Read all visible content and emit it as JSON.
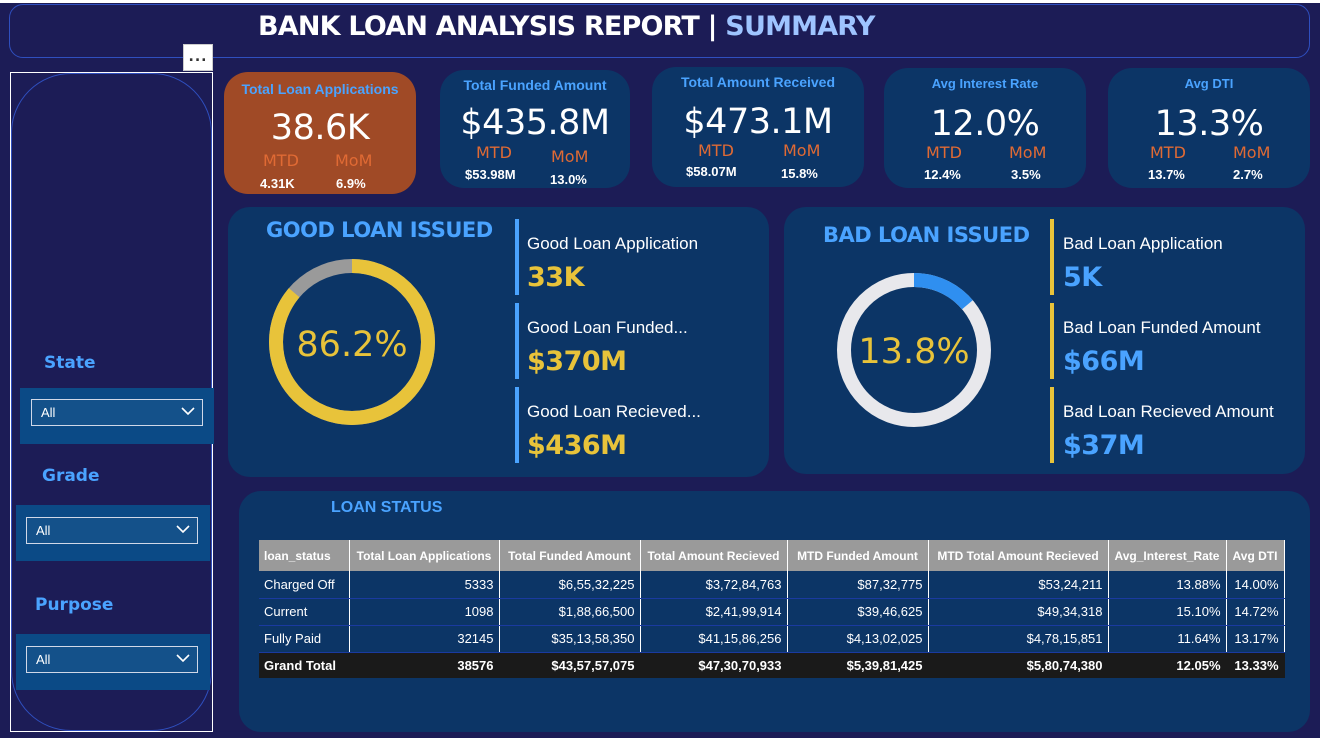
{
  "header": {
    "title_main": "BANK LOAN ANALYSIS REPORT",
    "title_sep": "|",
    "title_accent": "SUMMARY",
    "more_label": "..."
  },
  "slicers": [
    {
      "label": "State",
      "value": "All"
    },
    {
      "label": "Grade",
      "value": "All"
    },
    {
      "label": "Purpose",
      "value": "All"
    }
  ],
  "kpis": [
    {
      "title": "Total Loan Applications",
      "value": "38.6K",
      "mtd_label": "MTD",
      "mom_label": "MoM",
      "mtd": "4.31K",
      "mom": "6.9%"
    },
    {
      "title": "Total Funded Amount",
      "value": "$435.8M",
      "mtd_label": "MTD",
      "mom_label": "MoM",
      "mtd": "$53.98M",
      "mom": "13.0%"
    },
    {
      "title": "Total Amount Received",
      "value": "$473.1M",
      "mtd_label": "MTD",
      "mom_label": "MoM",
      "mtd": "$58.07M",
      "mom": "15.8%"
    },
    {
      "title": "Avg Interest Rate",
      "value": "12.0%",
      "mtd_label": "MTD",
      "mom_label": "MoM",
      "mtd": "12.4%",
      "mom": "3.5%"
    },
    {
      "title": "Avg DTI",
      "value": "13.3%",
      "mtd_label": "MTD",
      "mom_label": "MoM",
      "mtd": "13.7%",
      "mom": "2.7%"
    }
  ],
  "good_loan": {
    "title": "GOOD LOAN ISSUED",
    "percent_label": "86.2%",
    "percent": 0.862,
    "metrics": [
      {
        "label": "Good Loan Application",
        "value": "33K"
      },
      {
        "label": "Good Loan Funded...",
        "value": "$370M"
      },
      {
        "label": "Good Loan Recieved...",
        "value": "$436M"
      }
    ]
  },
  "bad_loan": {
    "title": "BAD LOAN ISSUED",
    "percent_label": "13.8%",
    "percent": 0.138,
    "metrics": [
      {
        "label": "Bad Loan Application",
        "value": "5K"
      },
      {
        "label": "Bad Loan Funded Amount",
        "value": "$66M"
      },
      {
        "label": "Bad Loan Recieved Amount",
        "value": "$37M"
      }
    ]
  },
  "loan_status": {
    "title": "LOAN STATUS",
    "columns": [
      "loan_status",
      "Total Loan Applications",
      "Total Funded Amount",
      "Total Amount Recieved",
      "MTD Funded Amount",
      "MTD Total Amount Recieved",
      "Avg_Interest_Rate",
      "Avg DTI"
    ],
    "rows": [
      [
        "Charged Off",
        "5333",
        "$6,55,32,225",
        "$3,72,84,763",
        "$87,32,775",
        "$53,24,211",
        "13.88%",
        "14.00%"
      ],
      [
        "Current",
        "1098",
        "$1,88,66,500",
        "$2,41,99,914",
        "$39,46,625",
        "$49,34,318",
        "15.10%",
        "14.72%"
      ],
      [
        "Fully Paid",
        "32145",
        "$35,13,58,350",
        "$41,15,86,256",
        "$4,13,02,025",
        "$4,78,15,851",
        "11.64%",
        "13.17%"
      ]
    ],
    "total": [
      "Grand Total",
      "38576",
      "$43,57,57,075",
      "$47,30,70,933",
      "$5,39,81,425",
      "$5,80,74,380",
      "12.05%",
      "13.33%"
    ]
  },
  "colors": {
    "background": "#1c1c56",
    "panel": "#0c3566",
    "accent_blue": "#4aa3ff",
    "accent_yellow": "#e8c33a",
    "kpi_orange": "#a04a26",
    "mtd_orange": "#e06a34"
  }
}
